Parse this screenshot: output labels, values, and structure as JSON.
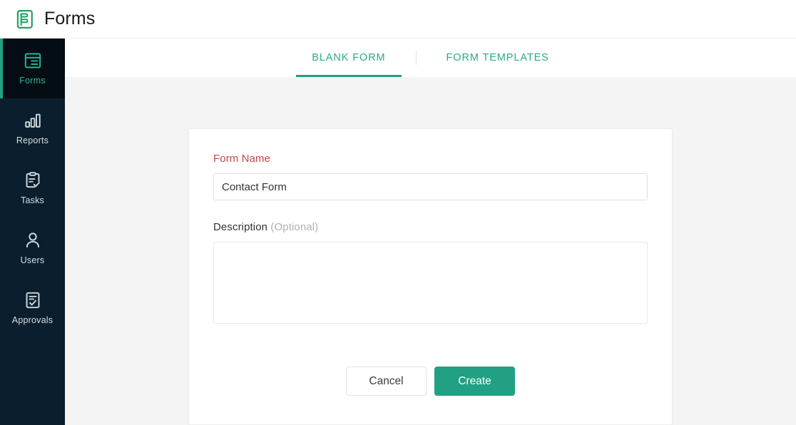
{
  "app": {
    "title": "Forms",
    "logo_icon": "forms-logo-icon",
    "accent_color": "#22a083",
    "sidebar_bg": "#0a1e2d",
    "content_bg": "#f4f4f4",
    "label_required_color": "#b94a48"
  },
  "sidebar": {
    "items": [
      {
        "label": "Forms",
        "icon": "forms-list-icon",
        "active": true
      },
      {
        "label": "Reports",
        "icon": "bar-chart-icon",
        "active": false
      },
      {
        "label": "Tasks",
        "icon": "clipboard-check-icon",
        "active": false
      },
      {
        "label": "Users",
        "icon": "user-icon",
        "active": false
      },
      {
        "label": "Approvals",
        "icon": "document-check-icon",
        "active": false
      }
    ]
  },
  "tabs": [
    {
      "label": "BLANK FORM",
      "active": true
    },
    {
      "label": "FORM TEMPLATES",
      "active": false
    }
  ],
  "form": {
    "name_label": "Form Name",
    "name_value": "Contact Form",
    "name_placeholder": "",
    "description_label": "Description",
    "description_optional": "(Optional)",
    "description_value": "",
    "description_placeholder": "",
    "cancel_label": "Cancel",
    "create_label": "Create"
  }
}
